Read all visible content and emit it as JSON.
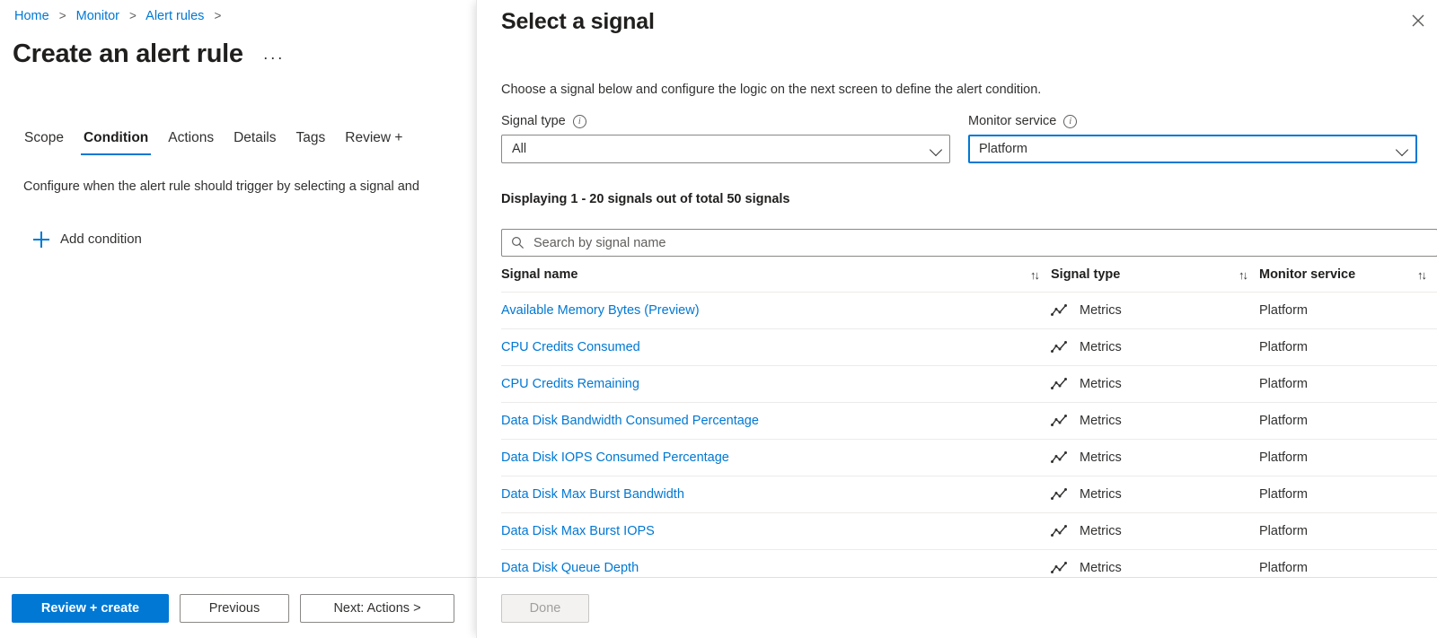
{
  "breadcrumb": {
    "items": [
      "Home",
      "Monitor",
      "Alert rules"
    ],
    "separator": ">"
  },
  "page": {
    "title": "Create an alert rule",
    "ellipsis_label": "···",
    "description": "Configure when the alert rule should trigger by selecting a signal and",
    "add_condition_label": "Add condition"
  },
  "tabs": [
    {
      "label": "Scope",
      "active": false
    },
    {
      "label": "Condition",
      "active": true
    },
    {
      "label": "Actions",
      "active": false
    },
    {
      "label": "Details",
      "active": false
    },
    {
      "label": "Tags",
      "active": false
    },
    {
      "label": "Review +",
      "active": false
    }
  ],
  "footer": {
    "review_create": "Review + create",
    "previous": "Previous",
    "next": "Next: Actions >"
  },
  "panel": {
    "title": "Select a signal",
    "close_icon": "close-icon",
    "subtitle": "Choose a signal below and configure the logic on the next screen to define the alert condition.",
    "signal_type": {
      "label": "Signal type",
      "info_icon": "info-icon",
      "value": "All",
      "focused": false
    },
    "monitor_service": {
      "label": "Monitor service",
      "info_icon": "info-icon",
      "value": "Platform",
      "focused": true
    },
    "displaying": "Displaying 1 - 20 signals out of total 50 signals",
    "search": {
      "placeholder": "Search by signal name",
      "value": "",
      "icon": "search-icon"
    },
    "table": {
      "columns": [
        {
          "label": "Signal name",
          "sort_icon": "↑↓"
        },
        {
          "label": "Signal type",
          "sort_icon": "↑↓"
        },
        {
          "label": "Monitor service",
          "sort_icon": "↑↓"
        }
      ],
      "rows": [
        {
          "name": "Available Memory Bytes (Preview)",
          "type": "Metrics",
          "service": "Platform",
          "type_icon": "metric-line-chart-icon"
        },
        {
          "name": "CPU Credits Consumed",
          "type": "Metrics",
          "service": "Platform",
          "type_icon": "metric-line-chart-icon"
        },
        {
          "name": "CPU Credits Remaining",
          "type": "Metrics",
          "service": "Platform",
          "type_icon": "metric-line-chart-icon"
        },
        {
          "name": "Data Disk Bandwidth Consumed Percentage",
          "type": "Metrics",
          "service": "Platform",
          "type_icon": "metric-line-chart-icon"
        },
        {
          "name": "Data Disk IOPS Consumed Percentage",
          "type": "Metrics",
          "service": "Platform",
          "type_icon": "metric-line-chart-icon"
        },
        {
          "name": "Data Disk Max Burst Bandwidth",
          "type": "Metrics",
          "service": "Platform",
          "type_icon": "metric-line-chart-icon"
        },
        {
          "name": "Data Disk Max Burst IOPS",
          "type": "Metrics",
          "service": "Platform",
          "type_icon": "metric-line-chart-icon"
        },
        {
          "name": "Data Disk Queue Depth",
          "type": "Metrics",
          "service": "Platform",
          "type_icon": "metric-line-chart-icon"
        }
      ]
    },
    "done_button": {
      "label": "Done",
      "disabled": true
    }
  },
  "colors": {
    "accent": "#0078d4",
    "link": "#0078d4",
    "text": "#323130",
    "border": "#8a8886",
    "row_divider": "#edebe9",
    "disabled_bg": "#f3f2f1",
    "disabled_text": "#a19f9d"
  }
}
